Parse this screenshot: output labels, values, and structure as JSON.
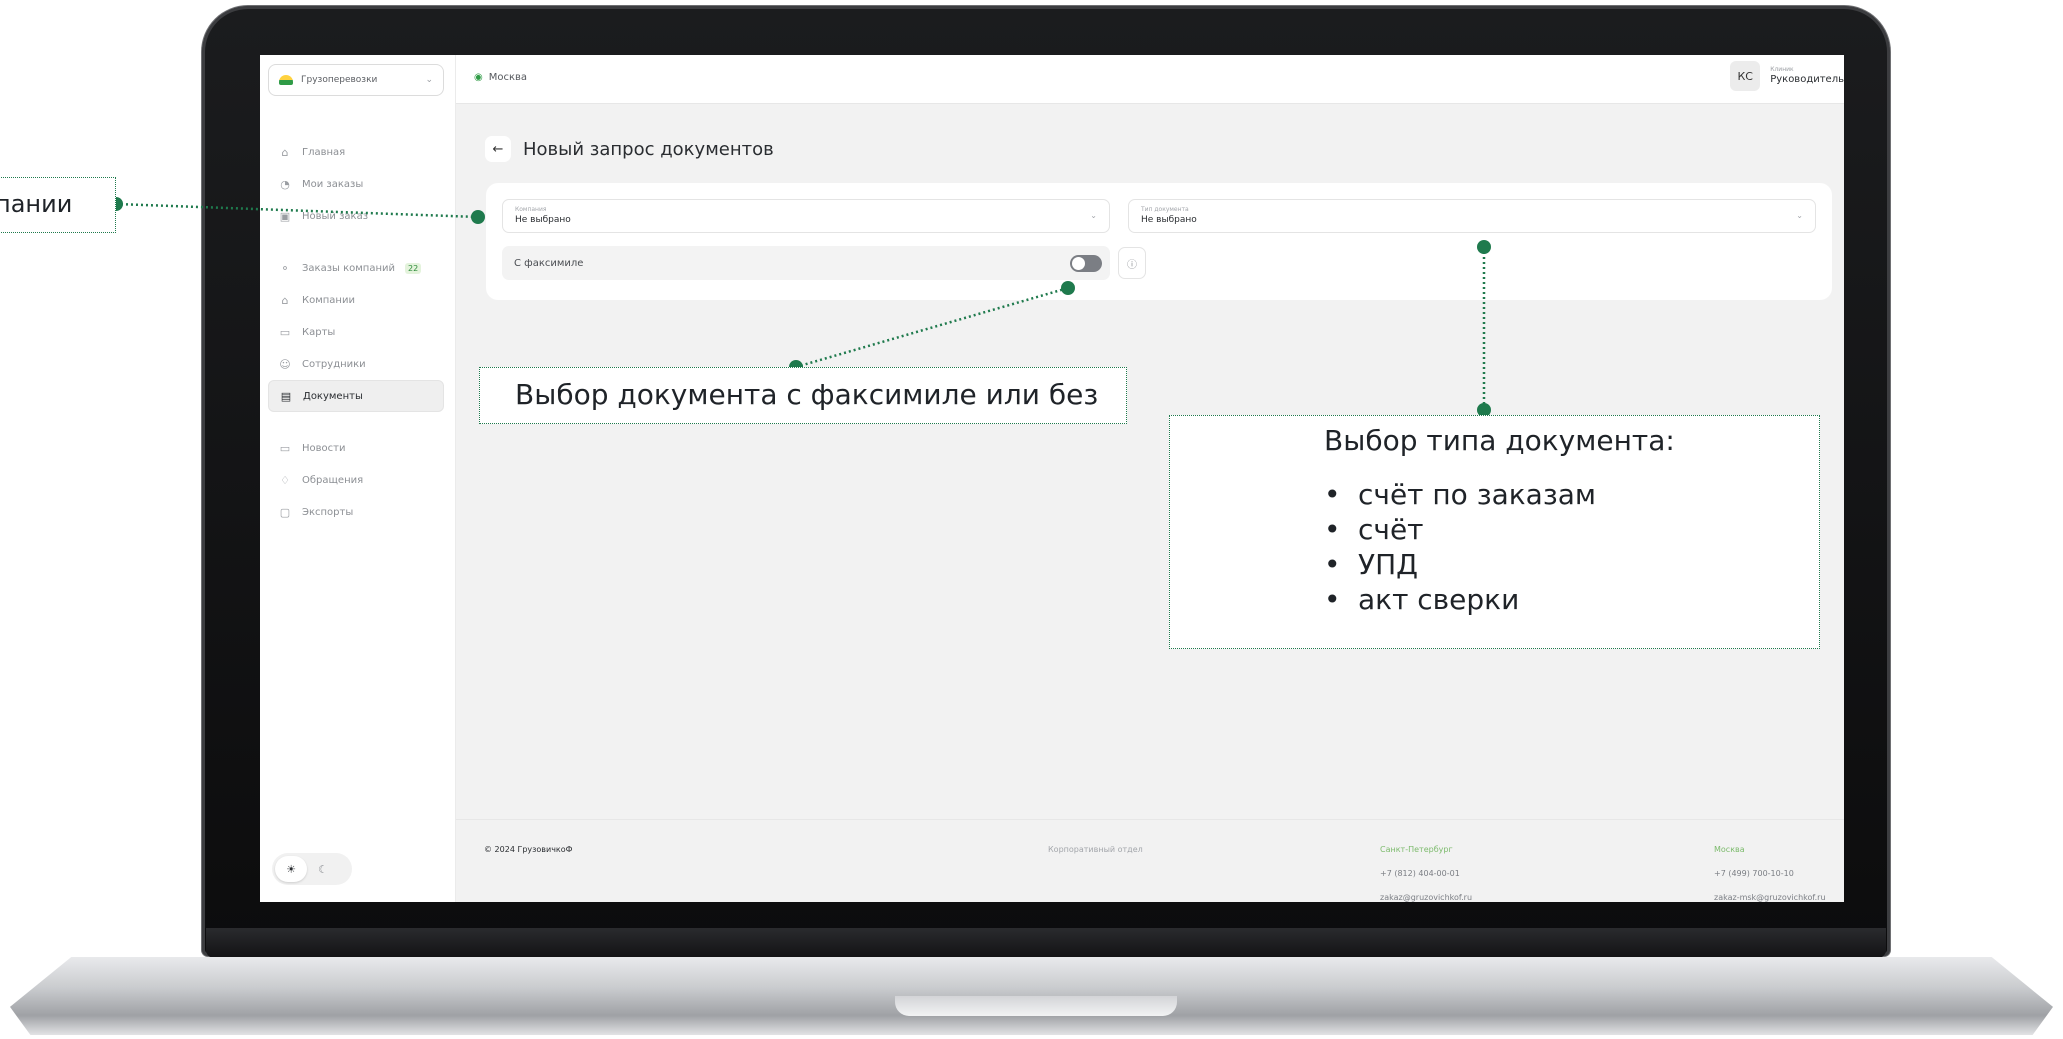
{
  "sidebar": {
    "company": "Грузоперевозки",
    "items": [
      {
        "label": "Главная",
        "icon": "home-icon"
      },
      {
        "label": "Мои заказы",
        "icon": "orders-icon"
      },
      {
        "label": "Новый заказ",
        "icon": "new-order-icon"
      },
      {
        "label": "Заказы компаний",
        "icon": "company-orders-icon",
        "badge": "22"
      },
      {
        "label": "Компании",
        "icon": "company-icon"
      },
      {
        "label": "Карты",
        "icon": "card-icon"
      },
      {
        "label": "Сотрудники",
        "icon": "employees-icon"
      },
      {
        "label": "Документы",
        "icon": "documents-icon",
        "active": true
      },
      {
        "label": "Новости",
        "icon": "news-icon"
      },
      {
        "label": "Обращения",
        "icon": "bell-icon"
      },
      {
        "label": "Экспорты",
        "icon": "export-icon"
      }
    ],
    "theme": {
      "light_icon": "sun-icon",
      "dark_icon": "moon-icon"
    }
  },
  "topbar": {
    "city": "Москва",
    "user": {
      "initials": "КС",
      "role": "Клиник",
      "name": "Руководитель"
    }
  },
  "page": {
    "title": "Новый запрос документов",
    "company_field": {
      "label": "Компания",
      "value": "Не выбрано"
    },
    "doc_type_field": {
      "label": "Тип документа",
      "value": "Не выбрано"
    },
    "facsimile": {
      "label": "С факсимиле",
      "enabled": false
    }
  },
  "footer": {
    "copyright": "© 2024 ГрузовичкоФ",
    "dept": "Корпоративный отдел",
    "spb": {
      "city": "Санкт-Петербург",
      "phone": "+7 (812) 404-00-01",
      "email": "zakaz@gruzovichkof.ru"
    },
    "msk": {
      "city": "Москва",
      "phone": "+7 (499) 700-10-10",
      "email": "zakaz-msk@gruzovichkof.ru"
    }
  },
  "annotations": {
    "left": "пании",
    "facsimile": "Выбор документа с факсимиле или без",
    "doc_type_title": "Выбор типа документа:",
    "doc_types": [
      "счёт по заказам",
      "счёт",
      "УПД",
      "акт сверки"
    ]
  },
  "colors": {
    "accent": "#1f7a4d",
    "brand_green": "#2f9b46"
  }
}
